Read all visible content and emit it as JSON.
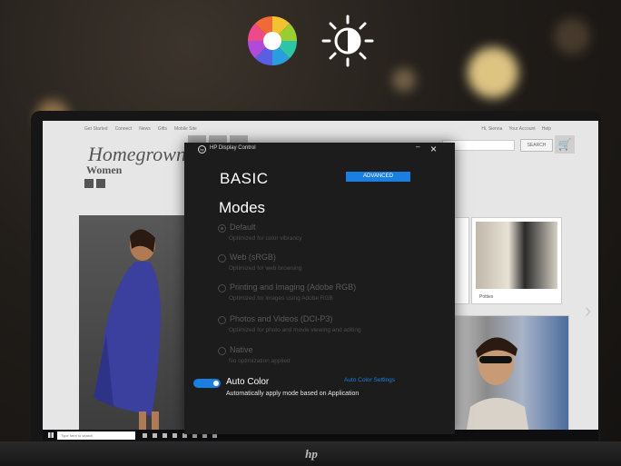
{
  "top_icons": {
    "color_wheel": "color-wheel-icon",
    "brightness": "brightness-icon"
  },
  "website": {
    "nav_left": [
      "Get Started",
      "Connect",
      "News",
      "Gifts",
      "Mobile Site"
    ],
    "nav_right": [
      "Hi, Sienna",
      "Your Account",
      "Help"
    ],
    "search_button": "SEARCH",
    "brand_line1": "Homegrown",
    "brand_line2": "Women",
    "thumb_caption": "Potties"
  },
  "taskbar": {
    "search_placeholder": "Type here to search"
  },
  "dialog": {
    "app_title": "HP Display Control",
    "minimize": "–",
    "close": "×",
    "heading": "BASIC",
    "advanced_button": "ADVANCED",
    "modes_heading": "Modes",
    "modes": [
      {
        "label": "Default",
        "sub": "Optimized for color vibrancy",
        "selected": true
      },
      {
        "label": "Web (sRGB)",
        "sub": "Optimized for web browsing",
        "selected": false
      },
      {
        "label": "Printing and Imaging (Adobe RGB)",
        "sub": "Optimized for images using Adobe RGB",
        "selected": false
      },
      {
        "label": "Photos and Videos (DCI-P3)",
        "sub": "Optimized for photo and movie viewing and editing",
        "selected": false
      },
      {
        "label": "Native",
        "sub": "No optimization applied",
        "selected": false
      }
    ],
    "auto_color": {
      "label": "Auto Color",
      "enabled": true,
      "settings_link": "Auto Color Settings",
      "sub": "Automatically apply mode based on Application"
    },
    "accent_color": "#1a7fe0"
  }
}
